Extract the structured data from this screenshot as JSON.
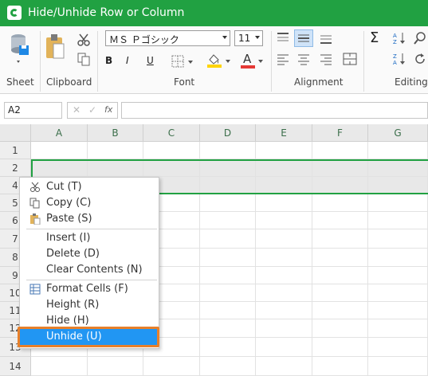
{
  "window": {
    "title": "Hide/Unhide Row or Column"
  },
  "ribbon": {
    "groups": {
      "sheet": "Sheet",
      "clipboard": "Clipboard",
      "font": "Font",
      "alignment": "Alignment",
      "editing": "Editing"
    },
    "font_name": "ＭＳ Ｐゴシック",
    "font_size": "11",
    "bold": "B",
    "italic": "I",
    "font_color_glyph": "A",
    "sigma": "Σ",
    "colors": {
      "accent": "#21a142",
      "font_color": "#e53935",
      "fill_color": "#ffd400",
      "selected": "#2196f3",
      "highlight": "#e8802a"
    }
  },
  "formula_bar": {
    "cell_ref": "A2",
    "fx": "fx"
  },
  "columns": [
    "A",
    "B",
    "C",
    "D",
    "E",
    "F",
    "G"
  ],
  "rows": [
    "1",
    "2",
    "4",
    "5",
    "6",
    "7",
    "8",
    "9",
    "10",
    "11",
    "12",
    "13",
    "14"
  ],
  "context_menu": {
    "items": [
      {
        "label": "Cut (T)",
        "icon": "scissors-icon"
      },
      {
        "label": "Copy (C)",
        "icon": "copy-icon"
      },
      {
        "label": "Paste (S)",
        "icon": "paste-icon"
      },
      {
        "label": "Insert (I)",
        "icon": ""
      },
      {
        "label": "Delete (D)",
        "icon": ""
      },
      {
        "label": "Clear Contents (N)",
        "icon": ""
      },
      {
        "label": "Format Cells (F)",
        "icon": "format-cells-icon"
      },
      {
        "label": "Height (R)",
        "icon": ""
      },
      {
        "label": "Hide (H)",
        "icon": ""
      },
      {
        "label": "Unhide (U)",
        "icon": ""
      }
    ]
  }
}
